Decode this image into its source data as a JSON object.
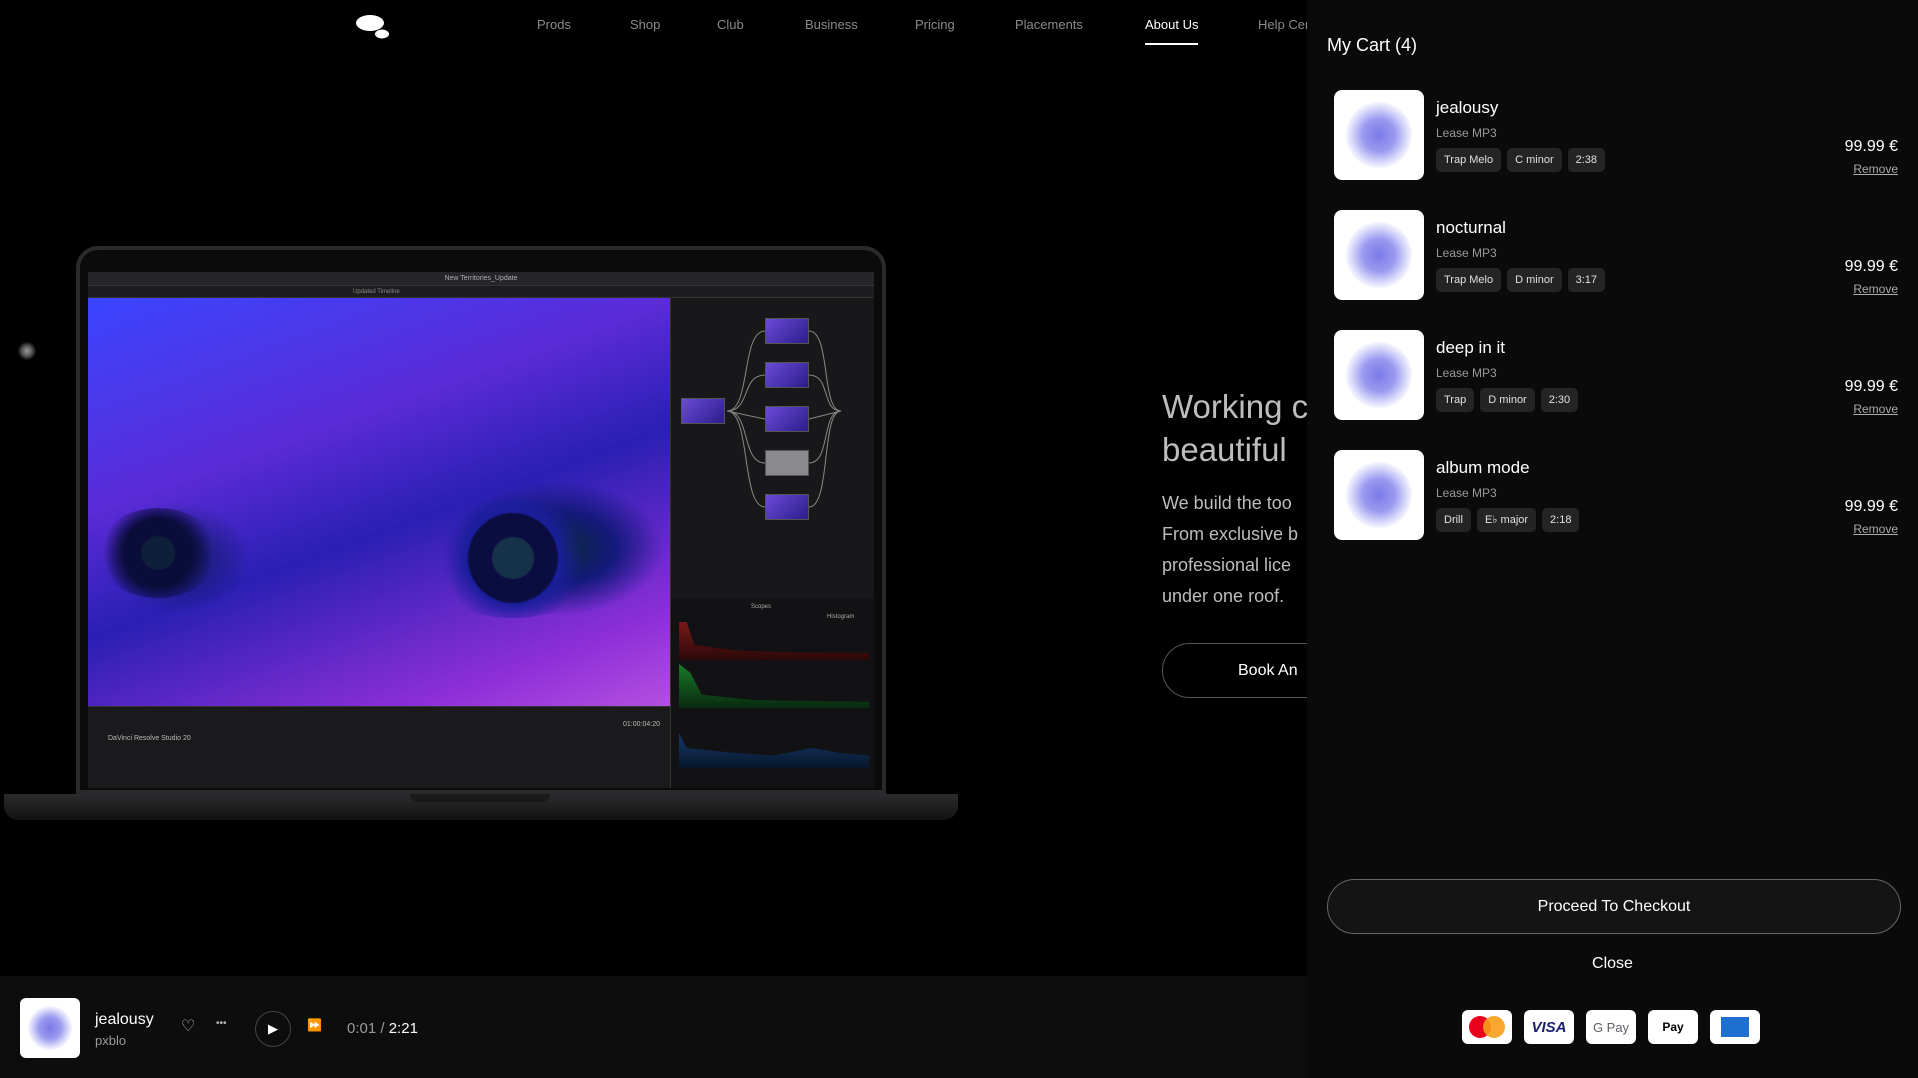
{
  "nav": {
    "items": [
      "Prods",
      "Shop",
      "Club",
      "Business",
      "Pricing",
      "Placements",
      "About Us",
      "Help Center"
    ],
    "active": "About Us"
  },
  "laptop": {
    "app_title": "New Territories_Update",
    "timeline_label": "Updated Timeline",
    "timecode": "01:00:04:20",
    "footer_label": "DaVinci Resolve Studio 20",
    "scopes_label": "Scopes",
    "histogram_label": "Histogram"
  },
  "hero": {
    "title_line1": "Working c",
    "title_line2": "beautiful",
    "body_lines": [
      "We build the too",
      "From exclusive b",
      "professional lice",
      "under one roof."
    ],
    "button_label": "Book An"
  },
  "cart": {
    "title": "My Cart (4)",
    "items": [
      {
        "name": "jealousy",
        "license": "Lease MP3",
        "tags": [
          "Trap Melo",
          "C minor",
          "2:38"
        ],
        "price": "99.99 €",
        "remove": "Remove"
      },
      {
        "name": "nocturnal",
        "license": "Lease MP3",
        "tags": [
          "Trap Melo",
          "D minor",
          "3:17"
        ],
        "price": "99.99 €",
        "remove": "Remove"
      },
      {
        "name": "deep in it",
        "license": "Lease MP3",
        "tags": [
          "Trap",
          "D minor",
          "2:30"
        ],
        "price": "99.99 €",
        "remove": "Remove"
      },
      {
        "name": "album mode",
        "license": "Lease MP3",
        "tags": [
          "Drill",
          "E♭ major",
          "2:18"
        ],
        "price": "99.99 €",
        "remove": "Remove"
      }
    ],
    "checkout_label": "Proceed To Checkout",
    "close_label": "Close",
    "payments": {
      "visa": "VISA",
      "gpay": "G Pay",
      "apay": " Pay"
    }
  },
  "player": {
    "title": "jealousy",
    "artist": "pxblo",
    "current_time": "0:01",
    "separator": "/",
    "duration": "2:21"
  },
  "icons": {
    "heart": "♡",
    "more": "•••",
    "play": "▶",
    "forward": "⏩"
  }
}
